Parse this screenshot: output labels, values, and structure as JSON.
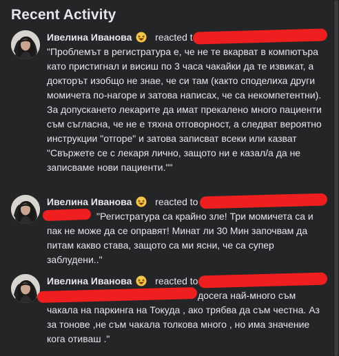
{
  "panel": {
    "title": "Recent Activity"
  },
  "activities": [
    {
      "name": "Ивелина Иванова",
      "reaction_icon": "laughing-face-emoji",
      "action": "reacted to",
      "comment": "\"Проблемът в регистратура е, че не те вкарват в компютъра като пристигнал и висиш по 3 часа чакайки да те извикат, а докторът изобщо не знае, че си там (както споделиха други момичета по-нагоре и затова написах, че са некомпетентни). За допускането лекарите да имат прекалено много пациенти съм съгласна, че не е тяхна отговорност, а следват вероятно инструкции \"отгоре\" и затова записват всеки или казват \"Свържете се с лекаря лично, защото ни е казал/а да не записваме нови пациенти.\"\""
    },
    {
      "name": "Ивелина Иванова",
      "reaction_icon": "laughing-face-emoji",
      "action": "reacted to",
      "comment": "\"Регистратура са крайно зле! Три момичета са и пак не може да се оправят! Минат ли 30 Мин започвам да питам какво става, защото са ми ясни, че са супер заблудени..\""
    },
    {
      "name": "Ивелина Иванова",
      "reaction_icon": "laughing-face-emoji",
      "action": "reacted to",
      "comment": "досега най-много съм чакала на паркинга на Токуда , ако трябва да съм честна. Аз за тонове ,не съм чакала толкова много , но има значение кога отиваш .\""
    }
  ],
  "colors": {
    "background": "#242526",
    "text": "#e4e6eb",
    "redaction": "#ef1f1f"
  }
}
